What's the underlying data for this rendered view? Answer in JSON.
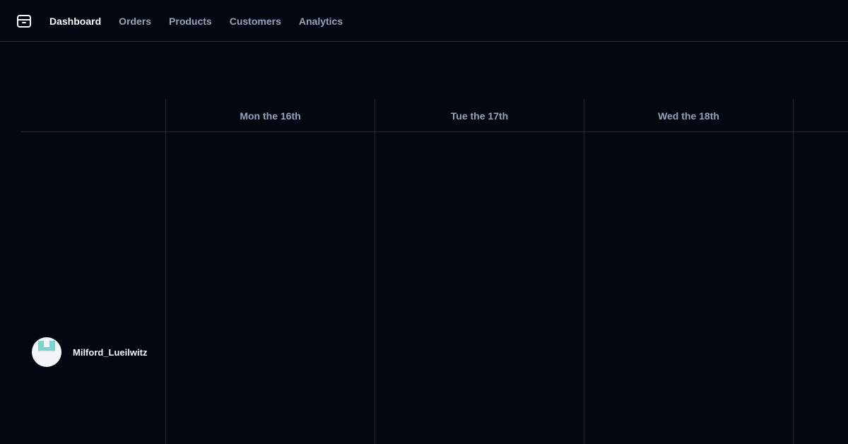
{
  "header": {
    "logo_icon": "package-icon",
    "nav": [
      {
        "label": "Dashboard",
        "active": true
      },
      {
        "label": "Orders",
        "active": false
      },
      {
        "label": "Products",
        "active": false
      },
      {
        "label": "Customers",
        "active": false
      },
      {
        "label": "Analytics",
        "active": false
      }
    ]
  },
  "schedule": {
    "days": [
      "Mon the 16th",
      "Tue the 17th",
      "Wed the 18th"
    ],
    "rows": [
      {
        "name": "Milford_Lueilwitz",
        "avatar_icon": "user-avatar"
      }
    ]
  },
  "colors": {
    "background": "#030712",
    "border": "#1f2937",
    "text_muted": "#94a3b8",
    "text_primary": "#f8fafc",
    "avatar_accent": "#7dd3cf"
  }
}
